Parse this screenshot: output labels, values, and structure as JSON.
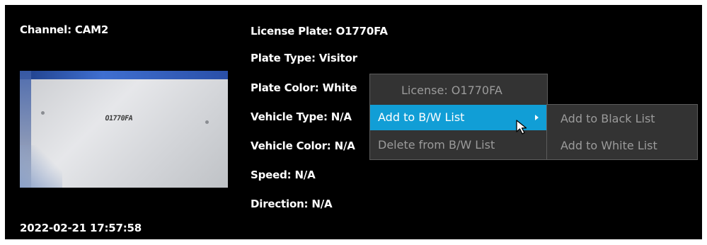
{
  "left": {
    "channel": "Channel: CAM2",
    "timestamp": "2022-02-21 17:57:58",
    "thumbnail_plate": "O1770FA"
  },
  "details": {
    "license_plate": "License Plate: O1770FA",
    "plate_type": "Plate Type: Visitor",
    "plate_color": "Plate Color: White",
    "vehicle_type": "Vehicle Type: N/A",
    "vehicle_color": "Vehicle Color: N/A",
    "speed": "Speed: N/A",
    "direction": "Direction: N/A"
  },
  "context_menu": {
    "header": "License: O1770FA",
    "add_to_bw_list": "Add to B/W List",
    "delete_from_bw_list": "Delete from B/W List"
  },
  "submenu": {
    "add_to_black_list": "Add to Black List",
    "add_to_white_list": "Add to White List"
  },
  "colors": {
    "highlight": "#119ed6",
    "menu_bg": "#333333",
    "panel_bg": "#000000"
  }
}
